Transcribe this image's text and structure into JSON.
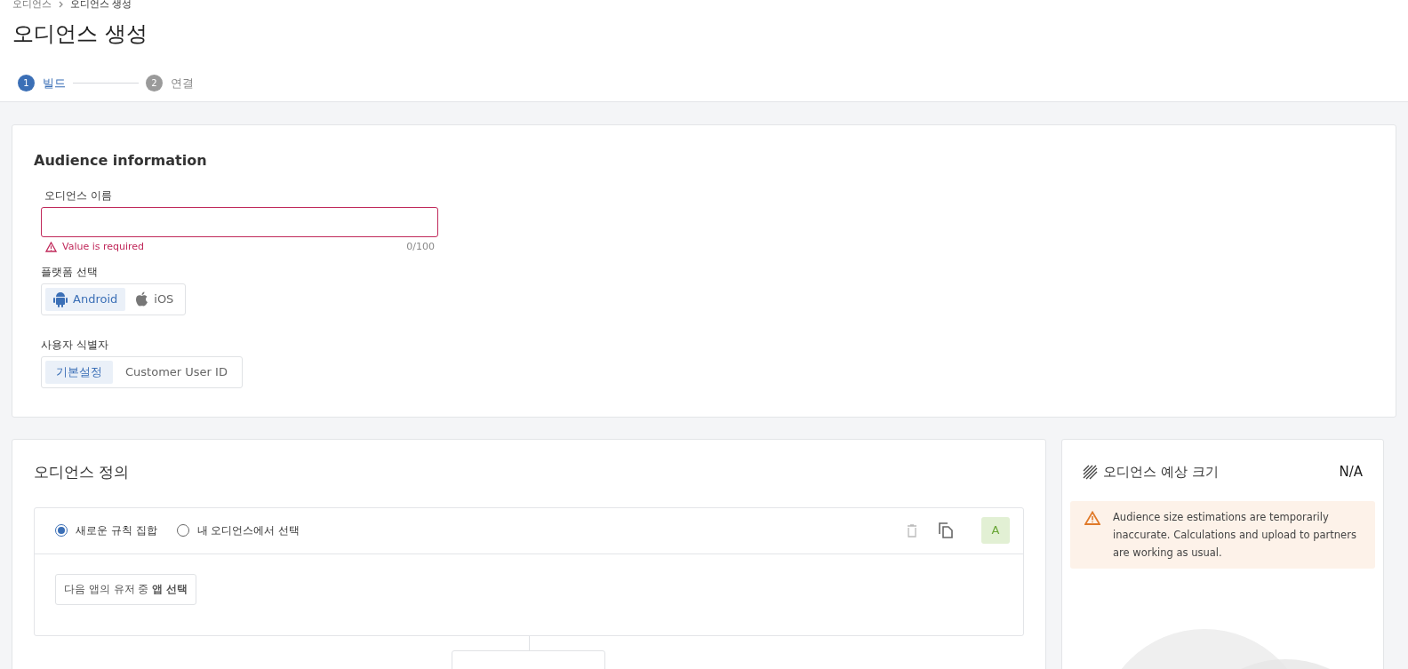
{
  "breadcrumb": [
    "오디언스",
    "오디언스 생성"
  ],
  "title": "오디언스 생성",
  "steps": [
    {
      "number": "1",
      "label": "빌드",
      "selected": true
    },
    {
      "number": "2",
      "label": "연결",
      "selected": false
    }
  ],
  "audience_info": {
    "title": "Audience information",
    "name_field": {
      "label": "오디언스 이름",
      "error": "Value is required",
      "counter": "0/100"
    },
    "platform": {
      "label": "플랫폼 선택",
      "options": [
        {
          "label": "Android",
          "kind": "android",
          "selected": true
        },
        {
          "label": "iOS",
          "kind": "apple",
          "selected": false
        }
      ]
    },
    "identifier": {
      "label": "사용자 식별자",
      "options": [
        {
          "label": "기본설정",
          "selected": true
        },
        {
          "label": "Customer User ID",
          "selected": false
        }
      ]
    }
  },
  "definition": {
    "title": "오디언스 정의",
    "radios": [
      {
        "label": "새로운 규칙 집합",
        "selected": true
      },
      {
        "label": "내 오디언스에서 선택",
        "selected": false
      }
    ],
    "badge": "A",
    "rule_button": "다음 앱의 유저 중 **앱 선택**"
  },
  "estimate": {
    "title": "오디언스 예상 크기",
    "value": "N/A",
    "warning": "Audience size estimations are temporarily inaccurate. Calculations and upload to partners are working as usual."
  }
}
